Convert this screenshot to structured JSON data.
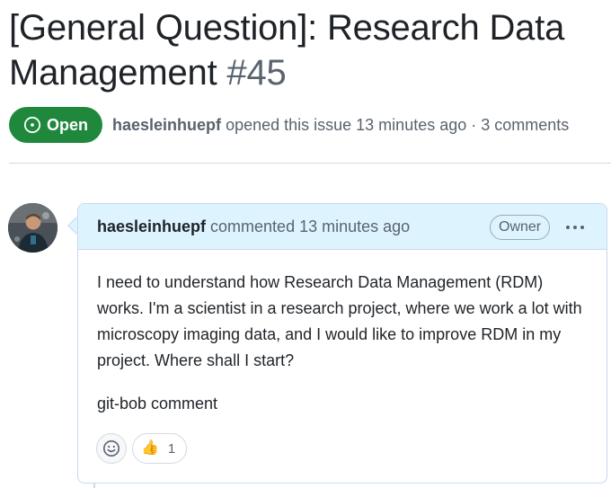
{
  "issue": {
    "title": "[General Question]: Research Data Management",
    "number": "#45",
    "state": "Open",
    "author": "haesleinhuepf",
    "meta": "opened this issue 13 minutes ago · 3 comments"
  },
  "comment": {
    "author": "haesleinhuepf",
    "meta": "commented 13 minutes ago",
    "role_badge": "Owner",
    "body_paragraph_1": "I need to understand how Research Data Management (RDM) works. I'm a scientist in a research project, where we work a lot with microscopy imaging data, and I would like to improve RDM in my project. Where shall I start?",
    "body_paragraph_2": "git-bob comment",
    "reactions": {
      "thumbs_up_emoji": "👍",
      "thumbs_up_count": "1"
    }
  },
  "colors": {
    "open_green": "#1f883d",
    "header_blue": "#ddf4ff",
    "muted_text": "#59636e"
  }
}
